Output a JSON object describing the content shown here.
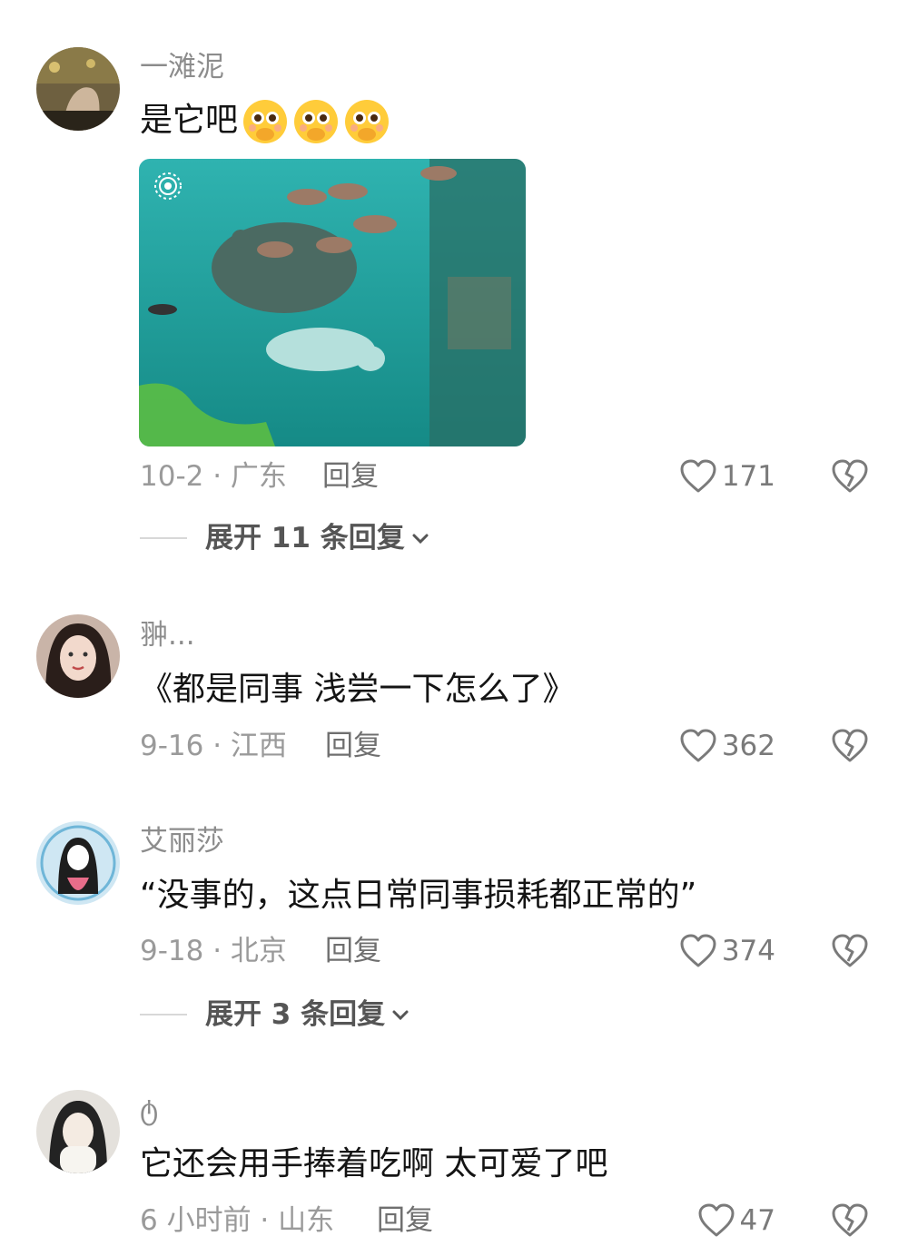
{
  "comments": [
    {
      "username": "一滩泥",
      "text": "是它吧",
      "emoji_icons": [
        "pleading-hands-emoji",
        "pleading-hands-emoji",
        "pleading-hands-emoji"
      ],
      "date_location": "10-2 · 广东",
      "reply_label": "回复",
      "likes": "171",
      "expand_label": "展开 11 条回复"
    },
    {
      "username": "翀...",
      "text": "《都是同事 浅尝一下怎么了》",
      "date_location": "9-16 · 江西",
      "reply_label": "回复",
      "likes": "362"
    },
    {
      "username": "艾丽莎",
      "text": "“没事的，这点日常同事损耗都正常的”",
      "date_location": "9-18 · 北京",
      "reply_label": "回复",
      "likes": "374",
      "expand_label": "展开 3 条回复"
    },
    {
      "username": "ტ",
      "text": "它还会用手捧着吃啊 太可爱了吧",
      "date_location": "6 小时前 · 山东",
      "reply_label": "回复",
      "likes": "47"
    }
  ],
  "icons": {
    "like": "heart-outline-icon",
    "dislike": "broken-heart-icon",
    "expand": "chevron-down-icon",
    "live_photo": "live-photo-icon"
  },
  "colors": {
    "text_primary": "#141414",
    "text_secondary": "#8c8c8c",
    "water": "#2fb3b0"
  }
}
